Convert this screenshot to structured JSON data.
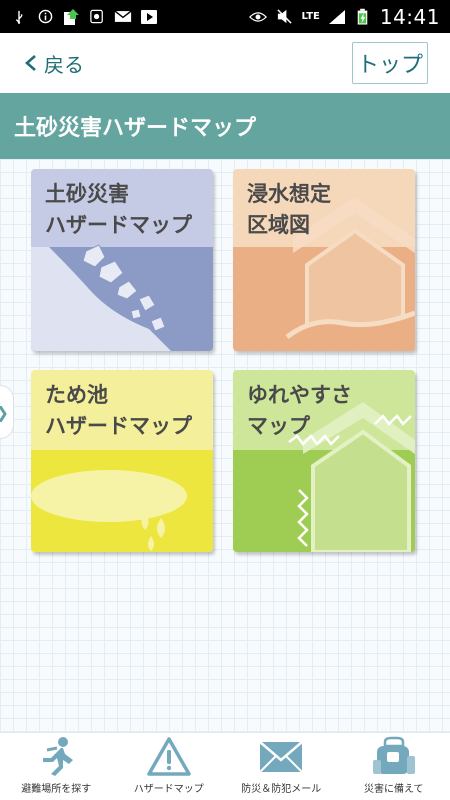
{
  "status_bar": {
    "time": "14:41",
    "network": "LTE",
    "icons": [
      "usb-icon",
      "info-icon",
      "upload-icon",
      "image-icon",
      "mail-icon",
      "play-icon",
      "eye-icon",
      "mute-icon",
      "signal-icon",
      "battery-icon"
    ]
  },
  "nav": {
    "back_label": "戻る",
    "top_label": "トップ"
  },
  "page_title": "土砂災害ハザードマップ",
  "tiles": [
    {
      "label": "土砂災害\nハザードマップ",
      "icon": "landslide-illustration"
    },
    {
      "label": "浸水想定\n区域図",
      "icon": "flood-house-illustration"
    },
    {
      "label": "ため池\nハザードマップ",
      "icon": "pond-illustration"
    },
    {
      "label": "ゆれやすさ\nマップ",
      "icon": "earthquake-house-illustration"
    }
  ],
  "bottom_nav": [
    {
      "label": "避難場所を探す",
      "icon": "running-person-icon"
    },
    {
      "label": "ハザードマップ",
      "icon": "warning-triangle-icon"
    },
    {
      "label": "防災＆防犯メール",
      "icon": "envelope-icon"
    },
    {
      "label": "災害に備えて",
      "icon": "emergency-kit-icon"
    }
  ],
  "colors": {
    "title_bar": "#65a5a0",
    "accent_text": "#1f6e78",
    "tile_landslide": "#c5cbe4",
    "tile_flood": "#f5d8ba",
    "tile_pond": "#f4ef9a",
    "tile_shake": "#cde69a"
  }
}
